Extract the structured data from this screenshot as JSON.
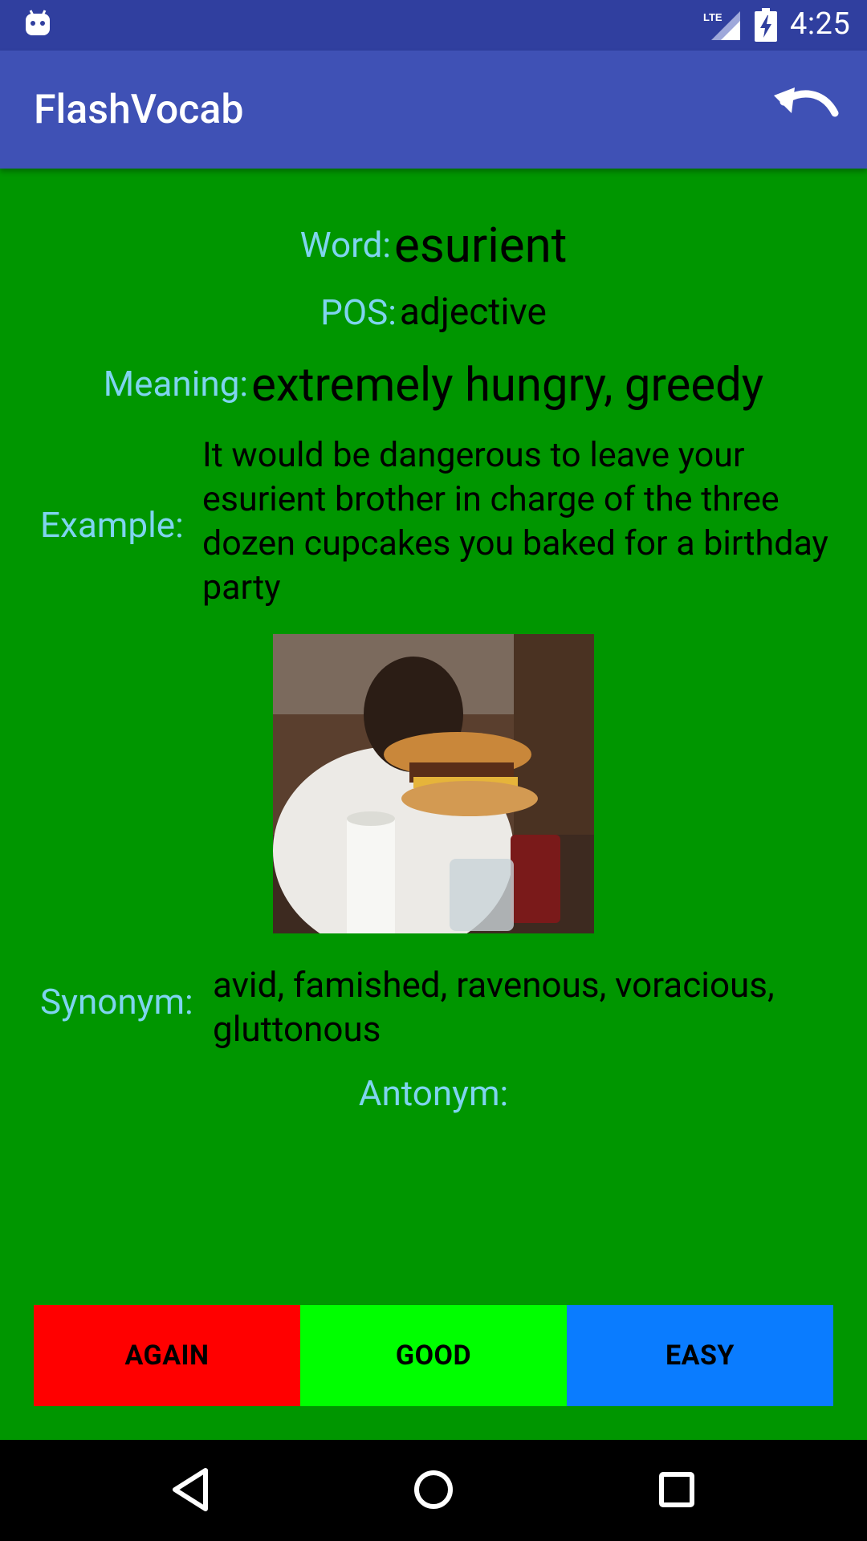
{
  "status_bar": {
    "time": "4:25",
    "network": "LTE",
    "icons": [
      "android-icon",
      "lte-signal-icon",
      "battery-charging-icon"
    ]
  },
  "app_bar": {
    "title": "FlashVocab",
    "undo_icon": "undo-icon"
  },
  "card": {
    "word_label": "Word:",
    "word": "esurient",
    "pos_label": "POS:",
    "pos": "adjective",
    "meaning_label": "Meaning:",
    "meaning": "extremely hungry, greedy",
    "example_label": "Example:",
    "example": "It would be dangerous to leave your esurient brother in charge of the three dozen cupcakes you baked for a birthday party",
    "synonym_label": "Synonym:",
    "synonym": "avid, famished, ravenous, voracious, gluttonous",
    "antonym_label": "Antonym:",
    "antonym": ""
  },
  "buttons": {
    "again": "AGAIN",
    "good": "GOOD",
    "easy": "EASY"
  },
  "colors": {
    "background": "#009600",
    "status_bar": "#303f9f",
    "app_bar": "#3f51b5",
    "label": "#7fd4ef",
    "again": "#ff0000",
    "good": "#00ff00",
    "easy": "#0a7cff"
  },
  "nav_bar": {
    "icons": [
      "back-icon",
      "home-icon",
      "recents-icon"
    ]
  }
}
